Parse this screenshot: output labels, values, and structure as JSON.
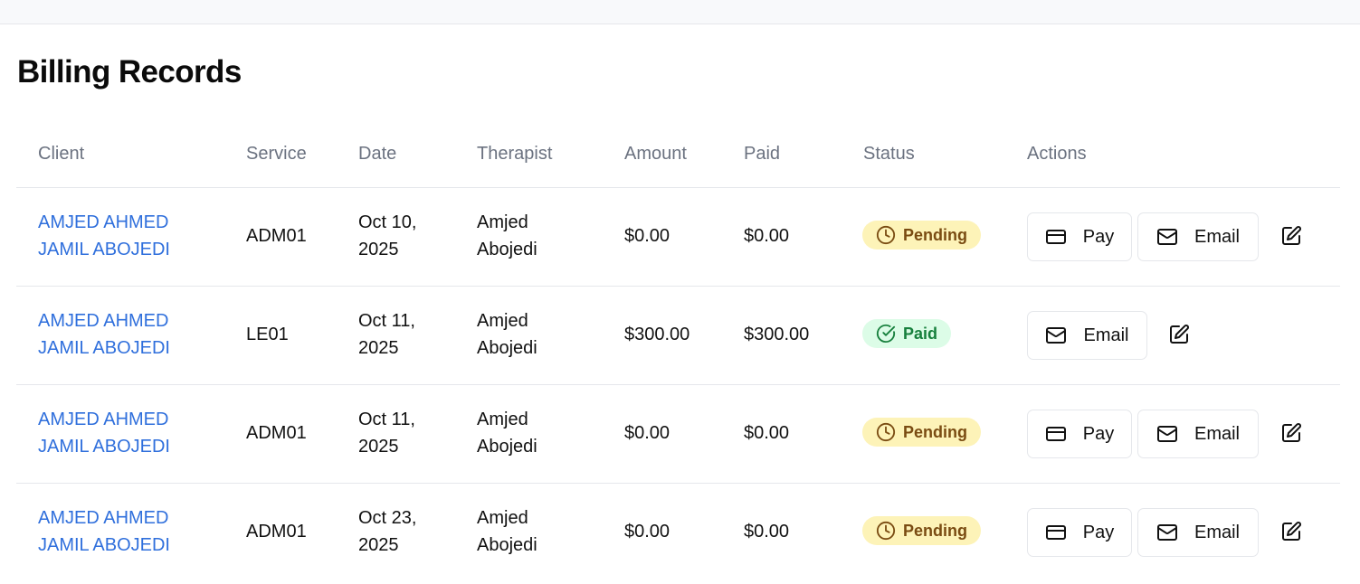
{
  "page": {
    "title": "Billing Records"
  },
  "table": {
    "headers": [
      "Client",
      "Service",
      "Date",
      "Therapist",
      "Amount",
      "Paid",
      "Status",
      "Actions"
    ],
    "rows": [
      {
        "client": "AMJED AHMED\nJAMIL ABOJEDI",
        "service": "ADM01",
        "date": "Oct 10,\n2025",
        "therapist": "Amjed\nAbojedi",
        "amount": "$0.00",
        "paid": "$0.00",
        "status": "Pending",
        "pay_label": "Pay",
        "email_label": "Email"
      },
      {
        "client": "AMJED AHMED\nJAMIL ABOJEDI",
        "service": "LE01",
        "date": "Oct 11,\n2025",
        "therapist": "Amjed\nAbojedi",
        "amount": "$300.00",
        "paid": "$300.00",
        "status": "Paid",
        "email_label": "Email"
      },
      {
        "client": "AMJED AHMED\nJAMIL ABOJEDI",
        "service": "ADM01",
        "date": "Oct 11,\n2025",
        "therapist": "Amjed\nAbojedi",
        "amount": "$0.00",
        "paid": "$0.00",
        "status": "Pending",
        "pay_label": "Pay",
        "email_label": "Email"
      },
      {
        "client": "AMJED AHMED\nJAMIL ABOJEDI",
        "service": "ADM01",
        "date": "Oct 23,\n2025",
        "therapist": "Amjed\nAbojedi",
        "amount": "$0.00",
        "paid": "$0.00",
        "status": "Pending",
        "pay_label": "Pay",
        "email_label": "Email"
      }
    ]
  },
  "icons": {
    "pending": "clock-icon",
    "paid": "check-circle-icon",
    "pay": "credit-card-icon",
    "email": "mail-icon",
    "edit": "edit-icon"
  },
  "colors": {
    "link": "#2f6fdc",
    "pending_bg": "#fdf3b8",
    "pending_text": "#7a4c12",
    "paid_bg": "#dcfce7",
    "paid_text": "#17803d"
  }
}
